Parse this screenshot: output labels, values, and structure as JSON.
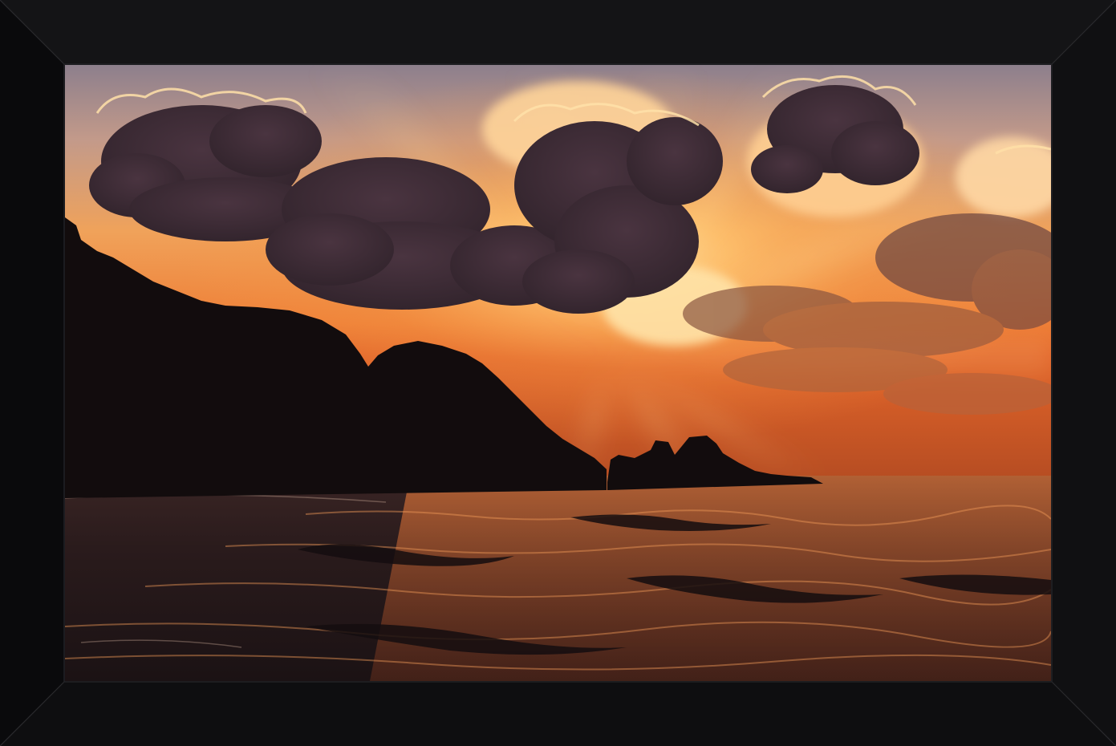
{
  "artwork": {
    "subject": "sunset-seascape",
    "frame_color": "#0c0c0e",
    "frame_highlight": "#2a2a2e",
    "colors": {
      "sky_top": "#8a7a86",
      "sky_glow": "#f4a24a",
      "sky_horizon": "#e2652a",
      "cloud_dark": "#3b2a33",
      "cloud_edge": "#ffd9a0",
      "land_silhouette": "#120c0d",
      "sea_dark": "#1e1416",
      "sea_reflection": "#b9582c"
    }
  }
}
